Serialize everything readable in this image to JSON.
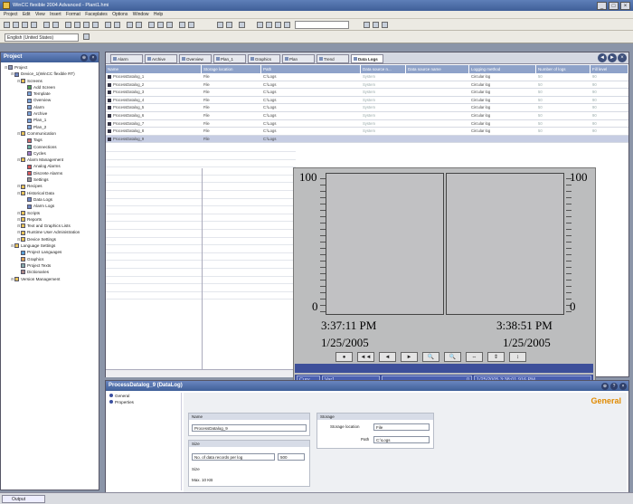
{
  "app": {
    "title": "WinCC flexible 2004 Advanced - Plant1.hmi",
    "window_buttons": [
      "_",
      "□",
      "×"
    ]
  },
  "menu": [
    "Project",
    "Edit",
    "View",
    "Insert",
    "Format",
    "Faceplates",
    "Options",
    "Window",
    "Help"
  ],
  "toolbar": {
    "language": "English (United States)"
  },
  "project_panel": {
    "title": "Project",
    "tree": [
      {
        "label": "Project",
        "level": 0,
        "icon": "project-icon"
      },
      {
        "label": "Device_1(WinCC flexible RT)",
        "level": 1,
        "icon": "device-icon"
      },
      {
        "label": "Screens",
        "level": 2,
        "icon": "folder-icon"
      },
      {
        "label": "Add Screen",
        "level": 3,
        "icon": "add-icon"
      },
      {
        "label": "Template",
        "level": 3,
        "icon": "screen-icon"
      },
      {
        "label": "Overview",
        "level": 3,
        "icon": "screen-icon"
      },
      {
        "label": "Alarm",
        "level": 3,
        "icon": "screen-icon"
      },
      {
        "label": "Archive",
        "level": 3,
        "icon": "screen-icon"
      },
      {
        "label": "Plan_1",
        "level": 3,
        "icon": "screen-icon"
      },
      {
        "label": "Plan_2",
        "level": 3,
        "icon": "screen-icon"
      },
      {
        "label": "Communication",
        "level": 2,
        "icon": "folder-icon"
      },
      {
        "label": "Tags",
        "level": 3,
        "icon": "tag-icon"
      },
      {
        "label": "Connections",
        "level": 3,
        "icon": "connection-icon"
      },
      {
        "label": "Cycles",
        "level": 3,
        "icon": "cycle-icon"
      },
      {
        "label": "Alarm Management",
        "level": 2,
        "icon": "folder-icon"
      },
      {
        "label": "Analog Alarms",
        "level": 3,
        "icon": "alarm-icon"
      },
      {
        "label": "Discrete Alarms",
        "level": 3,
        "icon": "alarm-icon"
      },
      {
        "label": "Settings",
        "level": 3,
        "icon": "settings-icon"
      },
      {
        "label": "Recipes",
        "level": 2,
        "icon": "folder-icon"
      },
      {
        "label": "Historical Data",
        "level": 2,
        "icon": "folder-icon"
      },
      {
        "label": "Data Logs",
        "level": 3,
        "icon": "log-icon"
      },
      {
        "label": "Alarm Logs",
        "level": 3,
        "icon": "log-icon"
      },
      {
        "label": "Scripts",
        "level": 2,
        "icon": "folder-icon"
      },
      {
        "label": "Reports",
        "level": 2,
        "icon": "folder-icon"
      },
      {
        "label": "Text and Graphics Lists",
        "level": 2,
        "icon": "folder-icon"
      },
      {
        "label": "Runtime User Administration",
        "level": 2,
        "icon": "folder-icon"
      },
      {
        "label": "Device Settings",
        "level": 2,
        "icon": "folder-icon"
      },
      {
        "label": "Language Settings",
        "level": 1,
        "icon": "folder-icon"
      },
      {
        "label": "Project Languages",
        "level": 2,
        "icon": "language-icon"
      },
      {
        "label": "Graphics",
        "level": 2,
        "icon": "graphics-icon"
      },
      {
        "label": "Project Texts",
        "level": 2,
        "icon": "text-icon"
      },
      {
        "label": "Dictionaries",
        "level": 2,
        "icon": "dictionary-icon"
      },
      {
        "label": "Version Management",
        "level": 1,
        "icon": "folder-icon"
      }
    ]
  },
  "editor": {
    "tabs": [
      "Alarm",
      "Archive",
      "Overview",
      "Plan_1",
      "Graphics",
      "Plan",
      "Trend",
      "Data Logs"
    ],
    "columns": [
      "Name",
      "Storage location",
      "Path",
      "Data source n...",
      "Data source name",
      "Logging method",
      "Number of logs",
      "Fill level"
    ],
    "rows": [
      [
        "ProcessDatalog_1",
        "File",
        "C:\\Logs",
        "System",
        "",
        "Circular log",
        "50",
        "90"
      ],
      [
        "ProcessDatalog_2",
        "File",
        "C:\\Logs",
        "System",
        "",
        "Circular log",
        "50",
        "90"
      ],
      [
        "ProcessDatalog_3",
        "File",
        "C:\\Logs",
        "System",
        "",
        "Circular log",
        "50",
        "90"
      ],
      [
        "ProcessDatalog_4",
        "File",
        "C:\\Logs",
        "System",
        "",
        "Circular log",
        "50",
        "90"
      ],
      [
        "ProcessDatalog_5",
        "File",
        "C:\\Logs",
        "System",
        "",
        "Circular log",
        "50",
        "90"
      ],
      [
        "ProcessDatalog_6",
        "File",
        "C:\\Logs",
        "System",
        "",
        "Circular log",
        "50",
        "90"
      ],
      [
        "ProcessDatalog_7",
        "File",
        "C:\\Logs",
        "System",
        "",
        "Circular log",
        "50",
        "90"
      ],
      [
        "ProcessDatalog_8",
        "File",
        "C:\\Logs",
        "System",
        "",
        "Circular log",
        "50",
        "90"
      ],
      [
        "ProcessDatalog_9",
        "File",
        "C:\\Logs",
        "",
        "",
        "",
        "",
        ""
      ]
    ],
    "selected_row": 8
  },
  "trend": {
    "y_max": "100",
    "y_min": "0",
    "left_time": "3:37:11 PM",
    "left_date": "1/25/2005",
    "right_time": "3:38:51 PM",
    "right_date": "1/25/2005",
    "buttons": [
      "●",
      "◄◄",
      "◄",
      "►",
      "🔍",
      "🔍",
      "⇔",
      "⇕",
      "↕"
    ],
    "table": {
      "cursor_label": "Curv",
      "var_label": "Var1",
      "value": "0",
      "timestamp": "1/25/2005 3:38:01.916 PM"
    }
  },
  "properties": {
    "title": "ProcessDatalog_9 (DataLog)",
    "nav": [
      "General",
      "Properties"
    ],
    "section": "General",
    "name_group": "Name",
    "name_value": "ProcessDatalog_9",
    "size_group": "Size",
    "records_label": "No. of data records per log",
    "records_value": "500",
    "size_label": "Size",
    "max_label": "Max. 10 KB",
    "storage_group": "Storage",
    "storage_location_label": "Storage location",
    "storage_location_value": "File",
    "path_label": "Path",
    "path_value": "C:\\Logs"
  },
  "status": {
    "output_tab": "Output"
  },
  "colors": {
    "accent": "#3f5f98",
    "header": "#8ea2c9",
    "trend_bar": "#3d4f9a",
    "general_label": "#e08a00"
  }
}
